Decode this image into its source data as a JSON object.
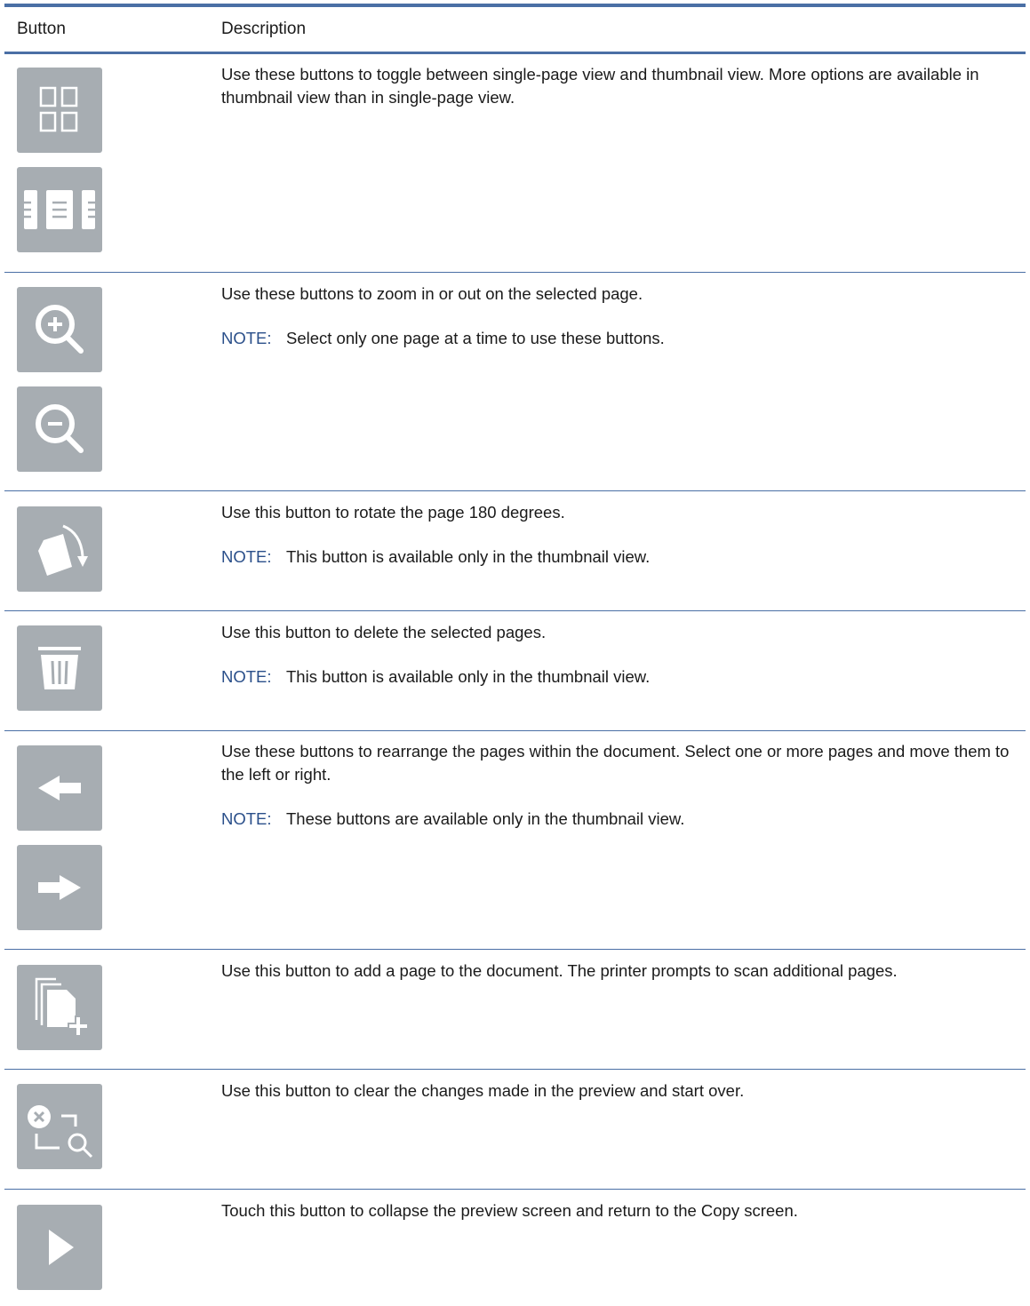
{
  "table": {
    "headers": {
      "button": "Button",
      "description": "Description"
    },
    "rows": [
      {
        "description": "Use these buttons to toggle between single-page view and thumbnail view. More options are available in thumbnail view than in single-page view.",
        "icons": [
          "thumbnail-view-icon",
          "single-page-view-icon"
        ]
      },
      {
        "description": "Use these buttons to zoom in or out on the selected page.",
        "note_label": "NOTE:",
        "note_text": "Select only one page at a time to use these buttons.",
        "icons": [
          "zoom-in-icon",
          "zoom-out-icon"
        ]
      },
      {
        "description": "Use this button to rotate the page 180 degrees.",
        "note_label": "NOTE:",
        "note_text": "This button is available only in the thumbnail view.",
        "icons": [
          "rotate-icon"
        ]
      },
      {
        "description": "Use this button to delete the selected pages.",
        "note_label": "NOTE:",
        "note_text": "This button is available only in the thumbnail view.",
        "icons": [
          "trash-icon"
        ]
      },
      {
        "description": "Use these buttons to rearrange the pages within the document. Select one or more pages and move them to the left or right.",
        "note_label": "NOTE:",
        "note_text": "These buttons are available only in the thumbnail view.",
        "icons": [
          "arrow-left-icon",
          "arrow-right-icon"
        ]
      },
      {
        "description": "Use this button to add a page to the document. The printer prompts to scan additional pages.",
        "icons": [
          "add-page-icon"
        ]
      },
      {
        "description": "Use this button to clear the changes made in the preview and start over.",
        "icons": [
          "reset-preview-icon"
        ]
      },
      {
        "description": "Touch this button to collapse the preview screen and return to the Copy screen.",
        "icons": [
          "collapse-play-icon"
        ]
      }
    ]
  },
  "colors": {
    "rule": "#4a6fa5",
    "button_bg": "#a7adb2",
    "note_label": "#2a4f8a"
  }
}
